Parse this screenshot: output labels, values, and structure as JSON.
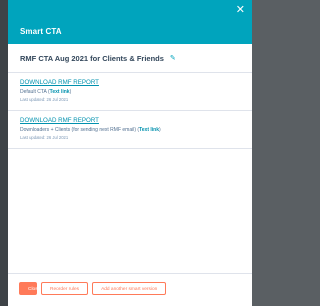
{
  "panel": {
    "title": "Smart CTA",
    "close_glyph": "✕"
  },
  "cta": {
    "name": "RMF CTA Aug 2021 for Clients & Friends",
    "edit_icon": "pencil-icon"
  },
  "variations": [
    {
      "link_label": "DOWNLOAD RMF REPORT",
      "audience": "Default CTA",
      "tag": "Text link",
      "updated": "Last updated: 26 Jul 2021"
    },
    {
      "link_label": "DOWNLOAD RMF REPORT",
      "audience": "Downloaders + Clients (for sending next RMF email)",
      "tag": "Text link",
      "updated": "Last updated: 26 Jul 2021"
    }
  ],
  "footer": {
    "close_label": "Close",
    "reorder_label": "Reorder rules",
    "add_label": "Add another smart version"
  },
  "colors": {
    "header": "#00a4bd",
    "accent": "#ff7a59",
    "link": "#0091ae"
  }
}
